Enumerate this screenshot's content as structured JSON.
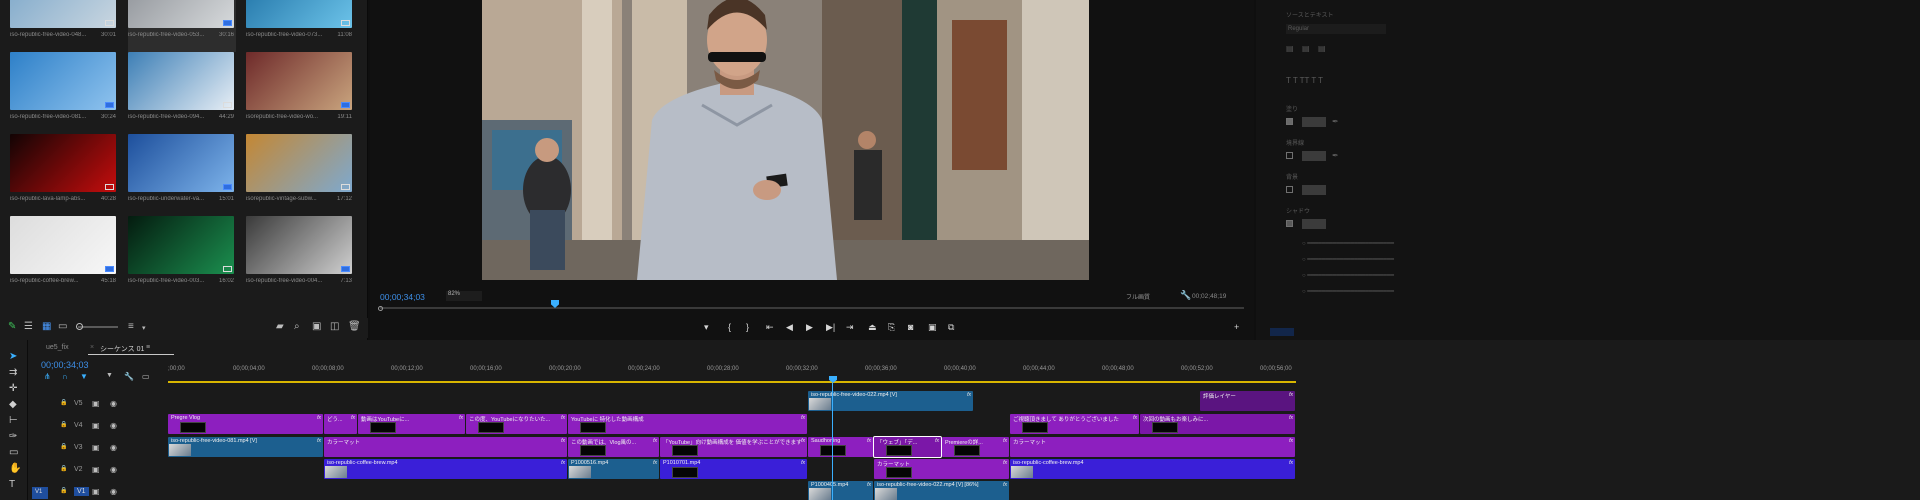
{
  "project": {
    "thumbnails": [
      {
        "name": "iso-republic-free-video-048...",
        "duration": "30:01",
        "colors": [
          "#7aa6c9",
          "#c9d6e0"
        ]
      },
      {
        "name": "iso-republic-free-video-053...",
        "duration": "30:16",
        "colors": [
          "#8b8f95",
          "#d7dadc"
        ]
      },
      {
        "name": "iso-republic-free-video-073...",
        "duration": "11:08",
        "colors": [
          "#1d6fa3",
          "#6cc3e9"
        ]
      },
      {
        "name": "iso-republic-free-video-081...",
        "duration": "30:24",
        "colors": [
          "#2e80c8",
          "#8fc3ee"
        ]
      },
      {
        "name": "iso-republic-free-video-094...",
        "duration": "44:29",
        "colors": [
          "#3d7fb6",
          "#e7eef5"
        ]
      },
      {
        "name": "isorepublic-free-video-wo...",
        "duration": "19:11",
        "colors": [
          "#6e2a2a",
          "#c9a47e"
        ]
      },
      {
        "name": "iso-republic-lava-lamp-abs...",
        "duration": "40:28",
        "colors": [
          "#120404",
          "#c40d0d"
        ]
      },
      {
        "name": "iso-republic-underwater-va...",
        "duration": "15:01",
        "colors": [
          "#1d4f9c",
          "#7db3ea"
        ]
      },
      {
        "name": "isorepublic-vintage-subw...",
        "duration": "17:12",
        "colors": [
          "#c48733",
          "#7ea9cf"
        ]
      },
      {
        "name": "iso-republic-coffee-brew...",
        "duration": "45:18",
        "colors": [
          "#dddddd",
          "#f7f7f7"
        ]
      },
      {
        "name": "iso-republic-free-video-003...",
        "duration": "16:02",
        "colors": [
          "#041b0f",
          "#1b8f4f"
        ]
      },
      {
        "name": "iso-republic-free-video-004...",
        "duration": "7:13",
        "colors": [
          "#3a3a3a",
          "#d0d0d0"
        ]
      }
    ]
  },
  "monitor": {
    "timecode": "00;00;34;03",
    "zoom": "82%",
    "quality": "フル画質",
    "duration": "00;02;48;19"
  },
  "timeline": {
    "tabs": [
      "ue5_fix",
      "シーケンス 01"
    ],
    "timecode": "00;00;34;03",
    "ruler": [
      ";00;00",
      "00;00;04;00",
      "00;00;08;00",
      "00;00;12;00",
      "00;00;16;00",
      "00;00;20;00",
      "00;00;24;00",
      "00;00;28;00",
      "00;00;32;00",
      "00;00;36;00",
      "00;00;40;00",
      "00;00;44;00",
      "00;00;48;00",
      "00;00;52;00",
      "00;00;56;00"
    ],
    "tracks": [
      "V5",
      "V4",
      "V3",
      "V2",
      "V1"
    ],
    "track_v1_src": "V1",
    "clips": {
      "v5_a": "iso-republic-free-video-022.mp4 [V]",
      "v5_b": "評価レイヤー",
      "v4_a": "Pregre Vlog",
      "v4_b": "どう...",
      "v4_c": "動画はYouTubeに...",
      "v4_d": "この度、YouTubeになりたいた...",
      "v4_e": "YouTubeに 特化した動画構成",
      "v4_f": "ご視聴頂きまして ありがとうございました",
      "v4_g": "次回の動画もお楽しみに...",
      "v3_a": "iso-republic-free-video-081.mp4 [V]",
      "v3_b": "カラーマット",
      "v3_c": "この動画では、Vlog風の...",
      "v3_d": "「YouTube」向け動画構成を 価値を学ぶことができます",
      "v3_e": "Saudhoning",
      "v3_f": "「ウェブ」「デ...",
      "v3_g": "Premiereの詳...",
      "v3_h": "カラーマット",
      "v2_a": "iso-republic-coffee-brew.mp4",
      "v2_b": "P1000516.mp4",
      "v2_c": "P1010701.mp4",
      "v2_d": "カラーマット",
      "v2_e": "iso-republic-coffee-brew.mp4",
      "v1_a": "P1000405.mp4",
      "v1_b": "iso-republic-free-video-022.mp4 [V] [86%]"
    }
  },
  "effects": {
    "title": "ソースとテキスト",
    "font_style": "Regular",
    "fill": "塗り",
    "stroke": "境界線",
    "background": "背景",
    "shadow": "シャドウ"
  }
}
